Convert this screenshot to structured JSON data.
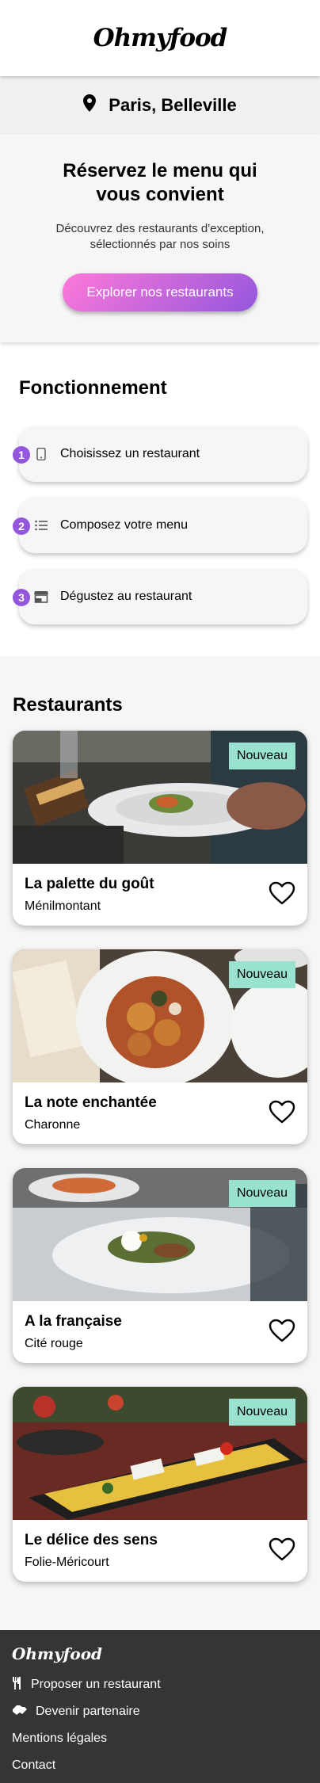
{
  "header": {
    "logo": "Ohmyfood"
  },
  "location": {
    "icon": "map-pin-icon",
    "label": "Paris, Belleville"
  },
  "hero": {
    "title": "Réservez le menu qui vous convient",
    "subtitle": "Découvrez des restaurants d'exception, sélectionnés par nos soins",
    "cta_label": "Explorer nos restaurants"
  },
  "how": {
    "title": "Fonctionnement",
    "steps": [
      {
        "num": "1",
        "icon": "phone-icon",
        "label": "Choisissez un restaurant"
      },
      {
        "num": "2",
        "icon": "list-icon",
        "label": "Composez votre menu"
      },
      {
        "num": "3",
        "icon": "store-icon",
        "label": "Dégustez au restaurant"
      }
    ]
  },
  "restaurants": {
    "title": "Restaurants",
    "items": [
      {
        "name": "La palette du goût",
        "area": "Ménilmontant",
        "badge": "Nouveau"
      },
      {
        "name": "La note enchantée",
        "area": "Charonne",
        "badge": "Nouveau"
      },
      {
        "name": "A la française",
        "area": "Cité rouge",
        "badge": "Nouveau"
      },
      {
        "name": "Le délice des sens",
        "area": "Folie-Méricourt",
        "badge": "Nouveau"
      }
    ]
  },
  "footer": {
    "logo": "Ohmyfood",
    "links": [
      {
        "icon": "utensils-icon",
        "label": "Proposer un restaurant"
      },
      {
        "icon": "handshake-icon",
        "label": "Devenir partenaire"
      },
      {
        "label": "Mentions légales"
      },
      {
        "label": "Contact"
      }
    ]
  },
  "colors": {
    "accent_start": "#ff79da",
    "accent_end": "#9356dc",
    "badge": "#99e2d0",
    "footer_bg": "#353535"
  }
}
